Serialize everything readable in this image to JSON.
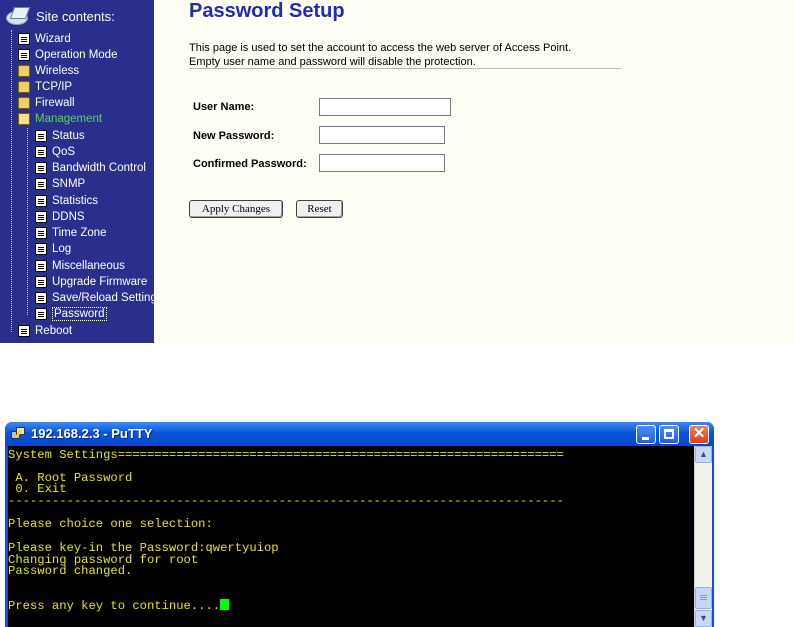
{
  "sidebar": {
    "header": "Site contents:",
    "items": [
      {
        "label": "Wizard",
        "icon": "doc-icon"
      },
      {
        "label": "Operation Mode",
        "icon": "doc-icon"
      },
      {
        "label": "Wireless",
        "icon": "folder-icon"
      },
      {
        "label": "TCP/IP",
        "icon": "folder-icon"
      },
      {
        "label": "Firewall",
        "icon": "folder-icon"
      },
      {
        "label": "Management",
        "icon": "folder-open-icon"
      },
      {
        "label": "Status",
        "icon": "doc-icon"
      },
      {
        "label": "QoS",
        "icon": "doc-icon"
      },
      {
        "label": "Bandwidth Control",
        "icon": "doc-icon"
      },
      {
        "label": "SNMP",
        "icon": "doc-icon"
      },
      {
        "label": "Statistics",
        "icon": "doc-icon"
      },
      {
        "label": "DDNS",
        "icon": "doc-icon"
      },
      {
        "label": "Time Zone",
        "icon": "doc-icon"
      },
      {
        "label": "Log",
        "icon": "doc-icon"
      },
      {
        "label": "Miscellaneous",
        "icon": "doc-icon"
      },
      {
        "label": "Upgrade Firmware",
        "icon": "doc-icon"
      },
      {
        "label": "Save/Reload Setting",
        "icon": "doc-icon"
      },
      {
        "label": "Password",
        "icon": "doc-icon"
      },
      {
        "label": "Reboot",
        "icon": "doc-icon"
      }
    ],
    "active_folder": "Management",
    "selected_item": "Password",
    "colors": {
      "background": "#2a2f8e",
      "active": "#59d65a"
    }
  },
  "page": {
    "title": "Password Setup",
    "description_line1": "This page is used to set the account to access the web server of Access Point.",
    "description_line2": "Empty user name and password will disable the protection.",
    "fields": {
      "username_label": "User Name:",
      "username_value": "",
      "new_password_label": "New Password:",
      "new_password_value": "",
      "confirm_password_label": "Confirmed Password:",
      "confirm_password_value": ""
    },
    "buttons": {
      "apply": "Apply Changes",
      "reset": "Reset"
    },
    "colors": {
      "title": "#1f2ab8",
      "background": "#fffef4"
    }
  },
  "putty": {
    "title": "192.168.2.3 - PuTTY",
    "terminal_lines": [
      "System Settings=============================================================",
      "",
      " A. Root Password",
      " 0. Exit",
      "----------------------------------------------------------------------------",
      "",
      "Please choice one selection:",
      "",
      "Please key-in the Password:qwertyuiop",
      "Changing password for root",
      "Password changed.",
      "",
      "",
      "Press any key to continue...."
    ],
    "colors": {
      "text": "#e6e600",
      "cursor": "#00ff00",
      "background": "#000000"
    }
  }
}
